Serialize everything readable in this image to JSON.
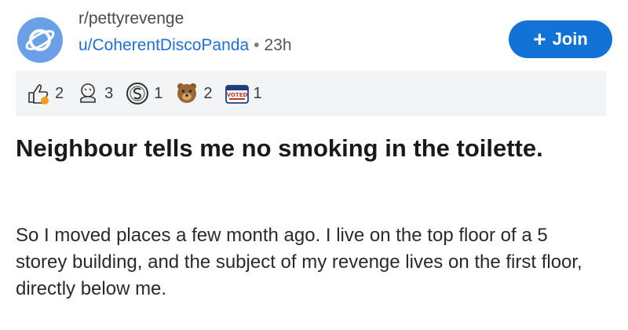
{
  "post": {
    "subreddit": "r/pettyrevenge",
    "username": "u/CoherentDiscoPanda",
    "separator": "•",
    "age": "23h",
    "join_label": "Join",
    "awards": [
      {
        "icon": "thumbs-up-award-icon",
        "count": "2"
      },
      {
        "icon": "wholesome-award-icon",
        "count": "3"
      },
      {
        "icon": "silver-coin-award-icon",
        "count": "1"
      },
      {
        "icon": "bear-award-icon",
        "count": "2"
      },
      {
        "icon": "voted-award-icon",
        "count": "1"
      }
    ],
    "title": "Neighbour tells me no smoking in the toilette.",
    "body": "So I moved places a few month ago. I live on the top floor of a 5 storey building, and the subject of my revenge lives on the first floor, directly below me."
  },
  "colors": {
    "join_button": "#1272d6",
    "username": "#1e6fd0",
    "avatar": "#6aa1e6",
    "awards_bar": "#f3f4f6"
  }
}
